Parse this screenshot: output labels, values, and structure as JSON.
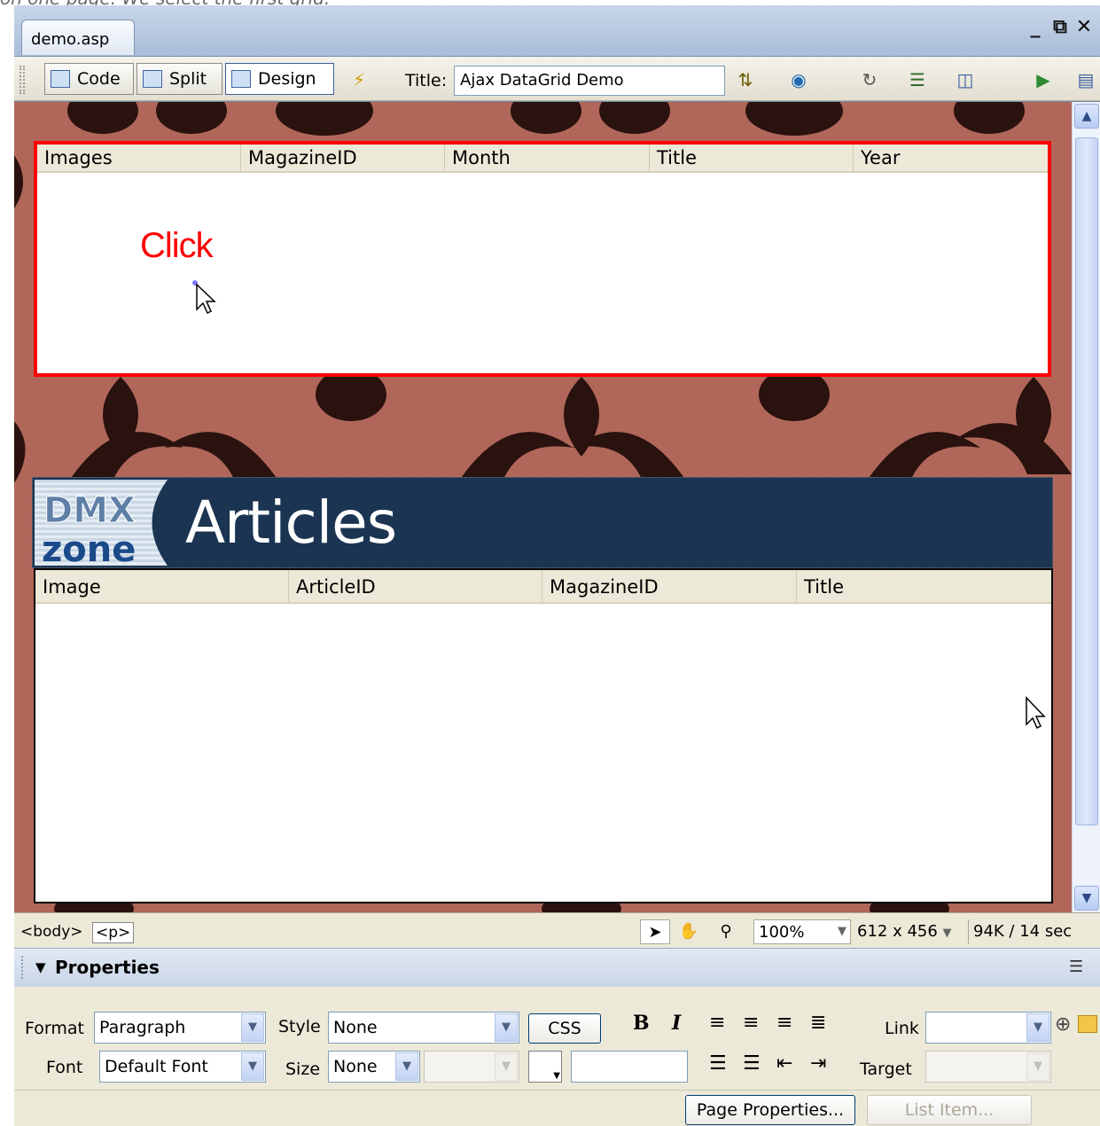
{
  "caption": "on one page. We select the first grid.",
  "document_tab": "demo.asp",
  "window_controls": {
    "minimize": "_",
    "restore": "⧉",
    "close": "✕"
  },
  "toolbar": {
    "code_label": "Code",
    "split_label": "Split",
    "design_label": "Design",
    "title_label": "Title:",
    "title_value": "Ajax DataGrid Demo"
  },
  "grid1": {
    "headers": [
      "Images",
      "MagazineID",
      "Month",
      "Title",
      "Year"
    ],
    "annotation": "Click"
  },
  "banner": {
    "title": "Articles",
    "logo_text_top": "DMX",
    "logo_text_bottom": "zone"
  },
  "grid2": {
    "headers": [
      "Image",
      "ArticleID",
      "MagazineID",
      "Title"
    ]
  },
  "statusbar": {
    "tag_body": "<body>",
    "tag_p": "<p>",
    "zoom": "100%",
    "dimensions": "612 x 456",
    "download": "94K / 14 sec"
  },
  "properties": {
    "title": "Properties",
    "format_label": "Format",
    "format_value": "Paragraph",
    "style_label": "Style",
    "style_value": "None",
    "css_button": "CSS",
    "link_label": "Link",
    "link_value": "",
    "font_label": "Font",
    "font_value": "Default Font",
    "size_label": "Size",
    "size_value": "None",
    "target_label": "Target",
    "bold": "B",
    "italic": "I",
    "page_properties_button": "Page Properties...",
    "list_item_button": "List Item..."
  }
}
